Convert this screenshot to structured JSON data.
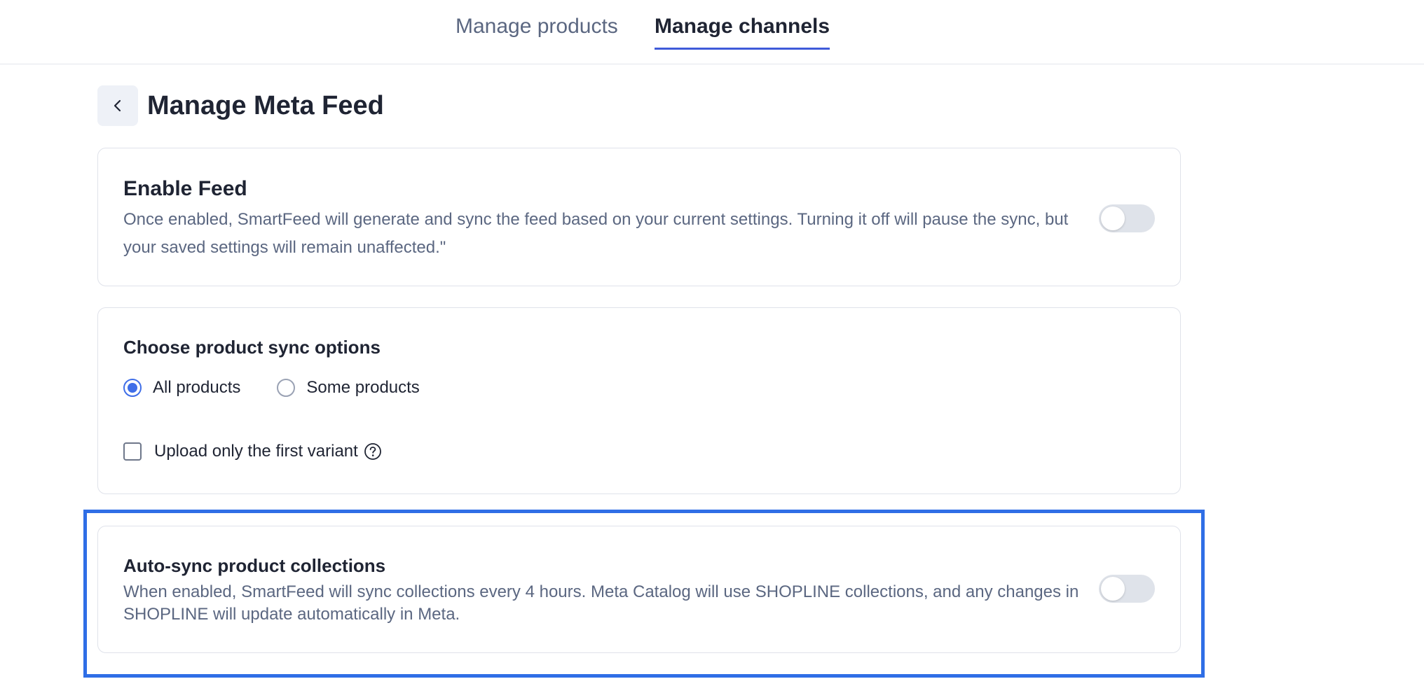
{
  "tabs": {
    "products": "Manage products",
    "channels": "Manage channels"
  },
  "header": {
    "title": "Manage Meta Feed"
  },
  "enable_feed": {
    "title": "Enable Feed",
    "description": "Once enabled, SmartFeed will generate and sync the feed based on your current settings. Turning it off will pause the sync, but your saved settings will remain unaffected.\"",
    "enabled": false
  },
  "sync_options": {
    "title": "Choose product sync options",
    "options": [
      {
        "label": "All products",
        "checked": true
      },
      {
        "label": "Some products",
        "checked": false
      }
    ],
    "first_variant_label": "Upload only the first variant",
    "first_variant_checked": false
  },
  "auto_sync": {
    "title": "Auto-sync product collections",
    "description": "When enabled, SmartFeed will sync collections every 4 hours. Meta Catalog will use SHOPLINE collections, and any changes in SHOPLINE will update automatically in Meta.",
    "enabled": false
  },
  "colors": {
    "accent": "#3f5bd9",
    "radio": "#3f6ee8",
    "highlight": "#2f6ee6"
  }
}
